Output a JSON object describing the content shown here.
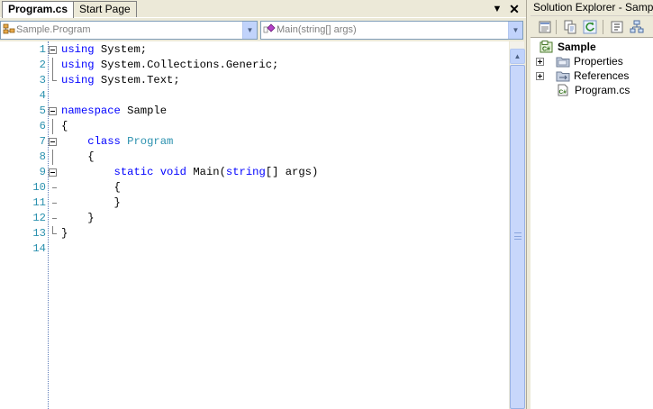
{
  "editor": {
    "tabs": [
      {
        "label": "Program.cs",
        "active": true
      },
      {
        "label": "Start Page",
        "active": false
      }
    ],
    "tab_dropdown_glyph": "▼",
    "tab_close_glyph": "✕",
    "navigation": {
      "type_combo": {
        "value": "Sample.Program",
        "icon": "class-icon"
      },
      "member_combo": {
        "value": "Main(string[] args)",
        "icon": "method-icon"
      },
      "arrow_glyph": "▼"
    },
    "code_lines": [
      {
        "number": "1",
        "tokens": [
          {
            "t": "using",
            "c": "kw"
          },
          {
            "t": " System;",
            "c": ""
          }
        ]
      },
      {
        "number": "2",
        "tokens": [
          {
            "t": "using",
            "c": "kw"
          },
          {
            "t": " System.Collections.Generic;",
            "c": ""
          }
        ]
      },
      {
        "number": "3",
        "tokens": [
          {
            "t": "using",
            "c": "kw"
          },
          {
            "t": " System.Text;",
            "c": ""
          }
        ]
      },
      {
        "number": "4",
        "tokens": []
      },
      {
        "number": "5",
        "tokens": [
          {
            "t": "namespace",
            "c": "kw"
          },
          {
            "t": " Sample",
            "c": ""
          }
        ]
      },
      {
        "number": "6",
        "tokens": [
          {
            "t": "{",
            "c": ""
          }
        ]
      },
      {
        "number": "7",
        "tokens": [
          {
            "t": "    ",
            "c": ""
          },
          {
            "t": "class",
            "c": "kw"
          },
          {
            "t": " ",
            "c": ""
          },
          {
            "t": "Program",
            "c": "ty"
          }
        ]
      },
      {
        "number": "8",
        "tokens": [
          {
            "t": "    {",
            "c": ""
          }
        ]
      },
      {
        "number": "9",
        "tokens": [
          {
            "t": "        ",
            "c": ""
          },
          {
            "t": "static",
            "c": "kw"
          },
          {
            "t": " ",
            "c": ""
          },
          {
            "t": "void",
            "c": "kw"
          },
          {
            "t": " Main(",
            "c": ""
          },
          {
            "t": "string",
            "c": "kw"
          },
          {
            "t": "[] args)",
            "c": ""
          }
        ]
      },
      {
        "number": "10",
        "tokens": [
          {
            "t": "        {",
            "c": ""
          }
        ]
      },
      {
        "number": "11",
        "tokens": [
          {
            "t": "        }",
            "c": ""
          }
        ]
      },
      {
        "number": "12",
        "tokens": [
          {
            "t": "    }",
            "c": ""
          }
        ]
      },
      {
        "number": "13",
        "tokens": [
          {
            "t": "}",
            "c": ""
          }
        ]
      },
      {
        "number": "14",
        "tokens": []
      }
    ],
    "scrollbar": {
      "up_glyph": "▲"
    }
  },
  "solution_explorer": {
    "title": "Solution Explorer - Sample",
    "toolbar": [
      "properties-icon",
      "show-all-files-icon",
      "refresh-icon",
      "view-code-icon",
      "class-diagram-icon"
    ],
    "tree": [
      {
        "label": "Sample",
        "bold": true,
        "icon": "csharp-project-icon",
        "expander": false
      },
      {
        "label": "Properties",
        "bold": false,
        "icon": "folder-icon",
        "expander": true
      },
      {
        "label": "References",
        "bold": false,
        "icon": "references-folder-icon",
        "expander": true
      },
      {
        "label": "Program.cs",
        "bold": false,
        "icon": "csharp-file-icon",
        "expander": false
      }
    ]
  },
  "colors": {
    "keyword": "#0000ff",
    "type": "#2b91af",
    "line_number": "#2b91af",
    "chrome": "#ece9d8"
  }
}
